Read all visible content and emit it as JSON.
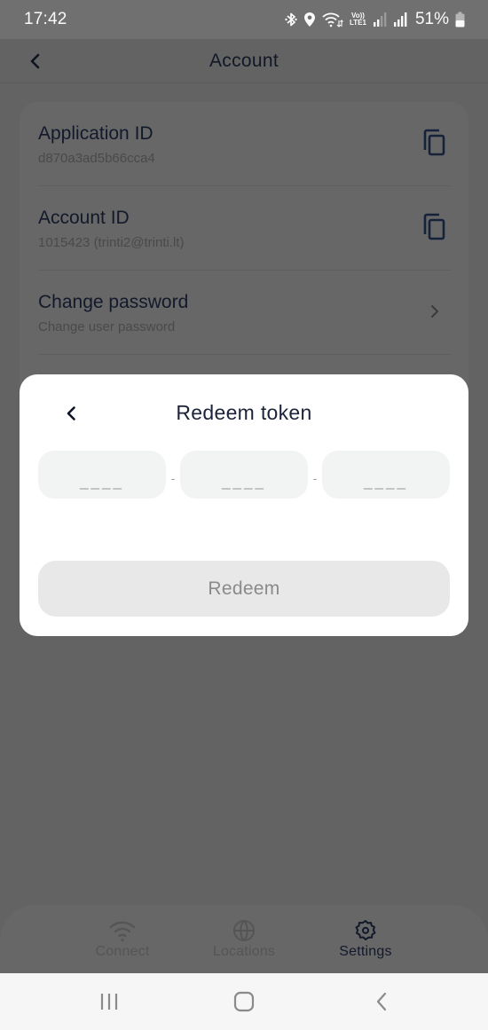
{
  "status_bar": {
    "time": "17:42",
    "network_label": "Vo)) LTE1",
    "battery": "51%",
    "icons": [
      "bluetooth-icon",
      "location-icon",
      "wifi-icon",
      "volte-icon",
      "signal-icon",
      "signal-icon",
      "battery-icon"
    ]
  },
  "header": {
    "title": "Account",
    "back_icon": "chevron-left-icon"
  },
  "account_items": [
    {
      "title": "Application ID",
      "subtitle": "d870a3ad5b66cca4",
      "action_icon": "copy-icon"
    },
    {
      "title": "Account ID",
      "subtitle": "1015423 (trinti2@trinti.lt)",
      "action_icon": "copy-icon"
    },
    {
      "title": "Change password",
      "subtitle": "Change user password",
      "action_icon": "chevron-right-icon"
    }
  ],
  "modal": {
    "title": "Redeem token",
    "back_icon": "chevron-left-icon",
    "token_fields": [
      {
        "value": "",
        "placeholder": "____"
      },
      {
        "value": "",
        "placeholder": "____"
      },
      {
        "value": "",
        "placeholder": "____"
      }
    ],
    "separator": "-",
    "redeem_label": "Redeem",
    "redeem_enabled": false
  },
  "tab_bar": {
    "tabs": [
      {
        "label": "Connect",
        "icon": "wifi-icon",
        "active": false
      },
      {
        "label": "Locations",
        "icon": "globe-icon",
        "active": false
      },
      {
        "label": "Settings",
        "icon": "gear-icon",
        "active": true
      }
    ]
  },
  "system_nav": {
    "buttons": [
      "recent-apps-icon",
      "home-icon",
      "back-icon"
    ]
  },
  "colors": {
    "overlay": "#636363",
    "modal_bg": "#ffffff",
    "field_bg": "#f2f3f3",
    "button_disabled_bg": "#e8e8e8",
    "button_disabled_text": "#8a8a8a",
    "title_text": "#1b2438",
    "active_tab": "#12192a"
  }
}
